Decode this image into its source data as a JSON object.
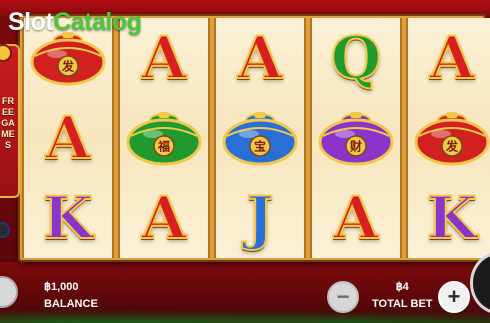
{
  "watermark": {
    "part1": "Slot",
    "part2": "Catalog"
  },
  "side_panel": {
    "text": "FREE GAMES"
  },
  "reels": [
    [
      "jar-red",
      "A",
      "K"
    ],
    [
      "A",
      "jar-green",
      "A"
    ],
    [
      "A",
      "jar-blue",
      "J"
    ],
    [
      "Q",
      "jar-purple",
      "A"
    ],
    [
      "A",
      "jar-red",
      "K"
    ]
  ],
  "jar_glyphs": {
    "jar-red": "发",
    "jar-green": "福",
    "jar-blue": "宝",
    "jar-purple": "财"
  },
  "colors": {
    "jar-red": "#d21f1f",
    "jar-green": "#1f9a2e",
    "jar-blue": "#2a6fd6",
    "jar-purple": "#8a34c9",
    "gold": "#f3c84a"
  },
  "balance": {
    "value": "฿1,000",
    "label": "BALANCE"
  },
  "bet": {
    "value": "฿4",
    "label": "TOTAL BET"
  },
  "buttons": {
    "minus": "−",
    "plus": "+"
  }
}
